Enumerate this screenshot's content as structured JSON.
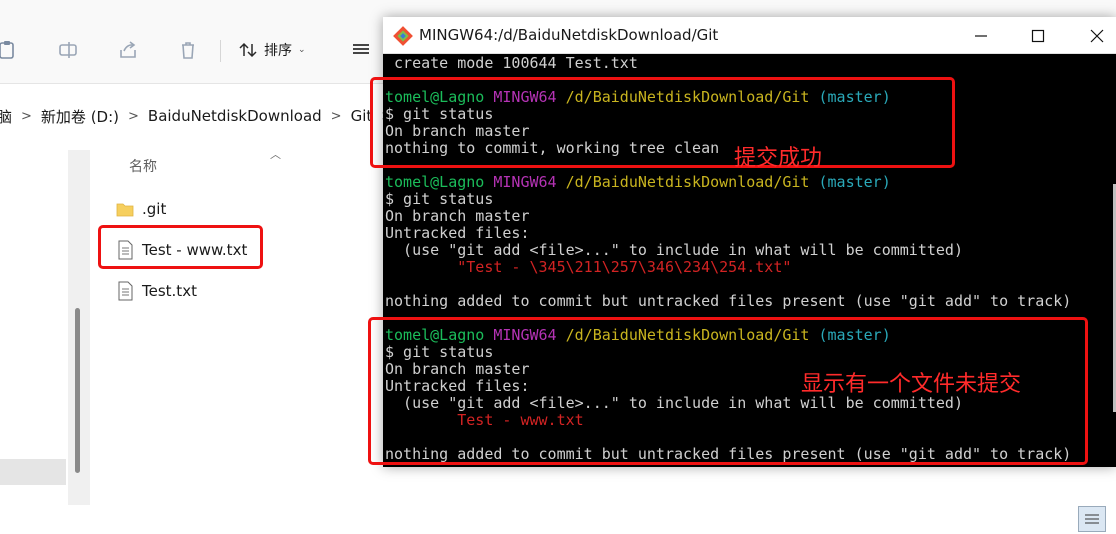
{
  "explorer": {
    "toolbar": {
      "sort_label": "排序"
    },
    "breadcrumb": [
      "脑",
      "新加卷 (D:)",
      "BaiduNetdiskDownload",
      "Git"
    ],
    "column_header": "名称",
    "files": [
      {
        "name": ".git",
        "type": "folder"
      },
      {
        "name": "Test - www.txt",
        "type": "text-file"
      },
      {
        "name": "Test.txt",
        "type": "text-file"
      }
    ]
  },
  "terminal": {
    "title": "MINGW64:/d/BaiduNetdiskDownload/Git",
    "header_line": " create mode 100644 Test.txt",
    "prompt": {
      "user": "tomel@Lagno",
      "system": "MINGW64",
      "path": "/d/BaiduNetdiskDownload/Git",
      "branch": "(master)"
    },
    "blocks": [
      {
        "command": "$ git status",
        "lines": [
          "On branch master",
          "nothing to commit, working tree clean"
        ]
      },
      {
        "command": "$ git status",
        "lines": [
          "On branch master",
          "Untracked files:",
          "  (use \"git add <file>...\" to include in what will be committed)"
        ],
        "untracked": "        \"Test - \\345\\211\\257\\346\\234\\254.txt\"",
        "footer": "nothing added to commit but untracked files present (use \"git add\" to track)"
      },
      {
        "command": "$ git status",
        "lines": [
          "On branch master",
          "Untracked files:",
          "  (use \"git add <file>...\" to include in what will be committed)"
        ],
        "untracked": "        Test - www.txt",
        "footer": "nothing added to commit but untracked files present (use \"git add\" to track)"
      }
    ]
  },
  "annotations": {
    "success": "提交成功",
    "untracked": "显示有一个文件未提交"
  },
  "colors": {
    "highlight": "#ee1111",
    "prompt_user": "#1bbc5a",
    "prompt_system": "#b533b5",
    "prompt_path": "#c8b41f",
    "prompt_branch": "#2aa9b9",
    "untracked_file": "#d22323"
  }
}
